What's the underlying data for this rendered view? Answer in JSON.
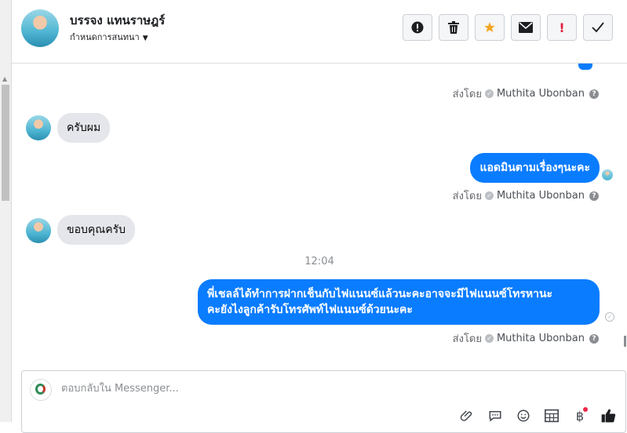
{
  "header": {
    "name": "บรรจง แทนราษฎร์",
    "conversation_settings": "กำหนดการสนทนา",
    "actions": [
      {
        "id": "spam",
        "icon": "alert-circle-icon",
        "glyph": "!"
      },
      {
        "id": "delete",
        "icon": "trash-icon",
        "glyph": "🗑"
      },
      {
        "id": "star",
        "icon": "star-icon",
        "glyph": "★",
        "color": "#f5a623"
      },
      {
        "id": "unread",
        "icon": "envelope-icon",
        "glyph": "✉"
      },
      {
        "id": "follow-up",
        "icon": "exclamation-icon",
        "glyph": "!",
        "color": "#e41e3f"
      },
      {
        "id": "done",
        "icon": "checkmark-icon",
        "glyph": "✓"
      }
    ]
  },
  "sent_by": {
    "prefix": "ส่งโดย",
    "agent": "Muthita Ubonban",
    "help": "?"
  },
  "messages": {
    "m1": "ครับผม",
    "m2": "แอดมินตามเรื่องๆนะคะ",
    "m3": "ขอบคุณครับ",
    "time": "12:04",
    "m4_line1": "พี่เชลล์ได้ทำการฝากเช็นกับไฟแนนซ์แล้วนะคะอาจจะมีไฟแนนซ์โทรหานะ",
    "m4_line2": "คะยังไงลูกค้ารับโทรศัพท์ไฟแนนซ์ด้วยนะคะ"
  },
  "composer": {
    "placeholder": "ตอบกลับใน Messenger...",
    "tools": [
      {
        "id": "attach",
        "icon": "paperclip-icon",
        "glyph": "📎"
      },
      {
        "id": "saved-replies",
        "icon": "chat-bubble-icon",
        "glyph": "💬"
      },
      {
        "id": "emoji",
        "icon": "smiley-icon",
        "glyph": "☺"
      },
      {
        "id": "appointments",
        "icon": "calendar-grid-icon",
        "glyph": "▦"
      },
      {
        "id": "payments",
        "icon": "currency-icon",
        "glyph": "฿"
      },
      {
        "id": "like",
        "icon": "thumbs-up-icon",
        "glyph": "👍"
      }
    ]
  },
  "colors": {
    "accent": "#0a7cff",
    "incoming": "#e4e6eb",
    "star": "#f5a623",
    "alert": "#e41e3f"
  }
}
